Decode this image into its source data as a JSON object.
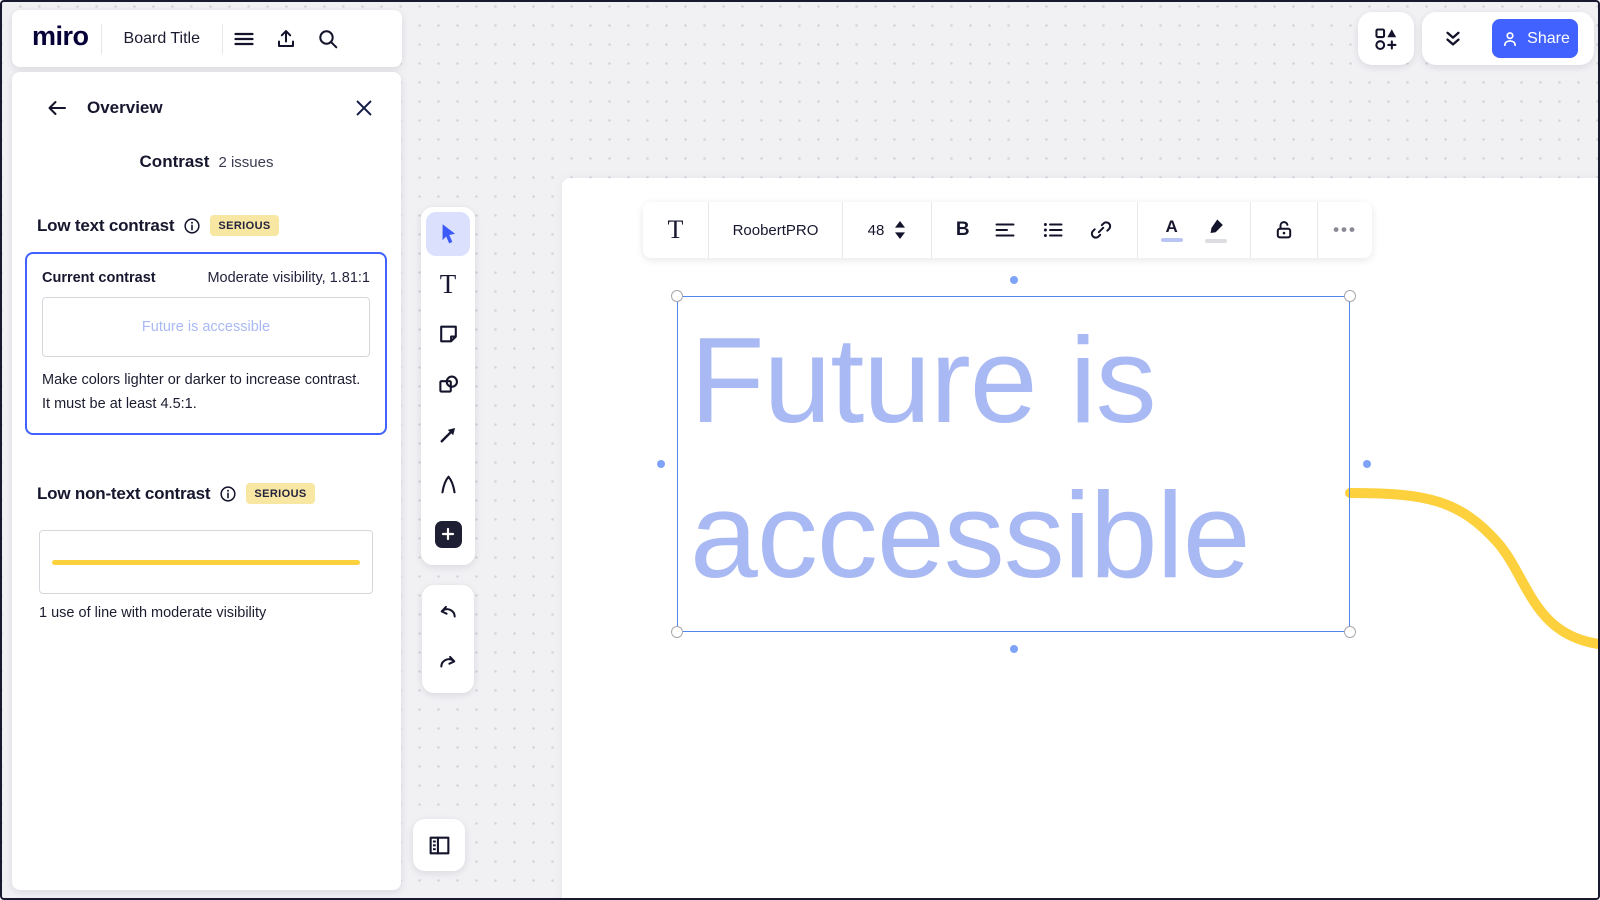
{
  "header": {
    "logo": "miro",
    "board_title": "Board Title",
    "share_label": "Share"
  },
  "panel": {
    "title": "Overview",
    "section_heading": "Contrast",
    "issues_count": "2 issues",
    "issue1": {
      "title": "Low text contrast",
      "severity": "SERIOUS",
      "current_label": "Current contrast",
      "visibility": "Moderate visibility, 1.81:1",
      "preview_text": "Future is accessible",
      "description": "Make colors lighter or darker to increase contrast. It must be at least 4.5:1."
    },
    "issue2": {
      "title": "Low non-text contrast",
      "severity": "SERIOUS",
      "caption": "1 use of line with moderate visibility"
    }
  },
  "text_toolbar": {
    "text_tool_glyph": "T",
    "font_name": "RoobertPRO",
    "font_size": "48",
    "bold_label": "B",
    "text_color_label": "A",
    "more_label": "•••"
  },
  "tools": {
    "text_tool_glyph": "T"
  },
  "canvas": {
    "text_line1": "Future is",
    "text_line2": "accessible"
  },
  "icons": {
    "menu": "☰",
    "export": "↥",
    "search": "⌕",
    "apps": "◻△◯+",
    "collapse": "⌄⌄",
    "person": "👤",
    "back": "←",
    "close": "✕",
    "info": "ⓘ",
    "select": "➤",
    "sticky-note": "▢",
    "shapes": "▢◯",
    "connector": "↗",
    "pen": "∧",
    "add": "+",
    "undo": "↶",
    "redo": "↷",
    "frames": "❏",
    "bullet-list": "≔",
    "align": "≡",
    "link": "🔗",
    "lock": "🔓"
  },
  "colors": {
    "accent": "#4262ff",
    "selection": "#4f86f0",
    "text_periwinkle": "#a9b9f3",
    "line_yellow": "#fcd13d",
    "badge_bg": "#f8e7a2",
    "brand_navy": "#050038",
    "canvas_bg": "#f1f1f4",
    "canvas_dot": "#cfcfd6"
  }
}
